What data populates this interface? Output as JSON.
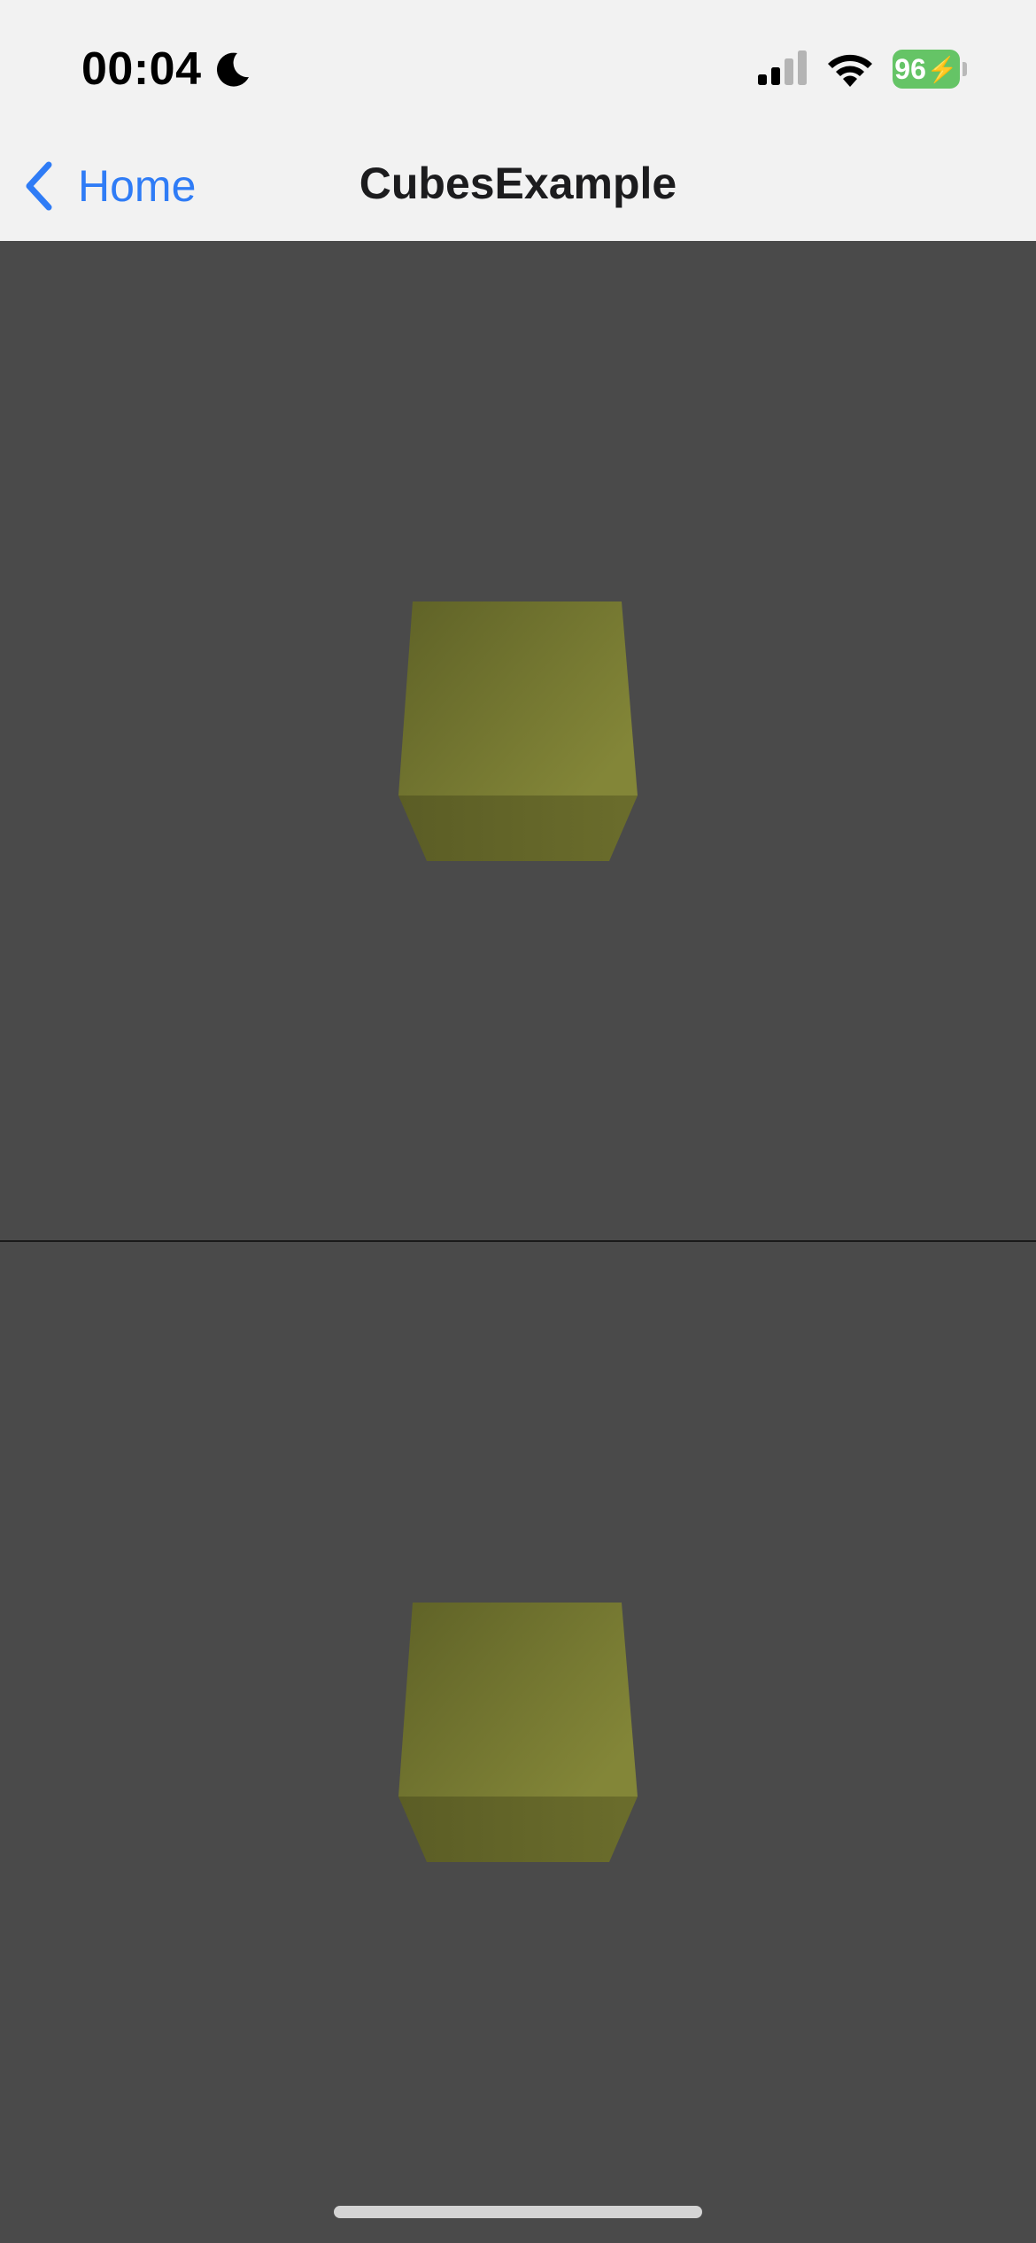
{
  "status_bar": {
    "time": "00:04",
    "focus_icon": "moon-icon",
    "signal_icon": "cellular-signal-icon",
    "wifi_icon": "wifi-icon",
    "battery_level": "96",
    "battery_charging": true,
    "battery_color": "#65c466"
  },
  "nav_bar": {
    "back_label": "Home",
    "back_icon": "chevron-left-icon",
    "title": "CubesExample",
    "accent_color": "#2f7cf6"
  },
  "scene": {
    "background_color": "#4a4a4a",
    "cube_color": "#7a7d33",
    "views": [
      "top-viewport",
      "bottom-viewport"
    ]
  }
}
